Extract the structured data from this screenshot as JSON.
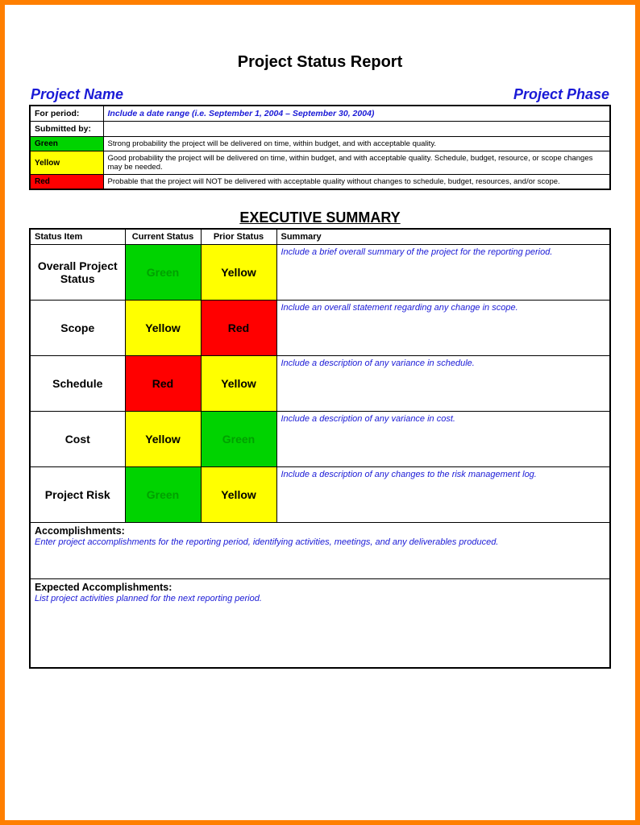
{
  "title": "Project Status Report",
  "subheadLeft": "Project Name",
  "subheadRight": "Project Phase",
  "info": {
    "periodLabel": "For period:",
    "periodInstr": "Include a date range (i.e. September 1, 2004 – September 30, 2004)",
    "submittedLabel": "Submitted by:"
  },
  "legend": {
    "green": {
      "name": "Green",
      "desc": "Strong probability the project will be delivered on time, within budget, and with acceptable quality."
    },
    "yellow": {
      "name": "Yellow",
      "desc": "Good probability the project will be delivered on time, within budget, and with acceptable quality. Schedule, budget, resource, or scope changes may be needed."
    },
    "red": {
      "name": "Red",
      "desc": "Probable that the project will NOT be delivered with acceptable quality without changes to schedule, budget, resources, and/or scope."
    }
  },
  "execTitle": "EXECUTIVE SUMMARY",
  "execHeaders": {
    "item": "Status Item",
    "current": "Current Status",
    "prior": "Prior Status",
    "summary": "Summary"
  },
  "rows": [
    {
      "item": "Overall Project Status",
      "current": "Green",
      "prior": "Yellow",
      "summary": "Include a brief overall summary of the project for the reporting period."
    },
    {
      "item": "Scope",
      "current": "Yellow",
      "prior": "Red",
      "summary": "Include an overall statement regarding any change in scope."
    },
    {
      "item": "Schedule",
      "current": "Red",
      "prior": "Yellow",
      "summary": "Include a description of any variance in schedule."
    },
    {
      "item": "Cost",
      "current": "Yellow",
      "prior": "Green",
      "summary": "Include a description of any variance in cost."
    },
    {
      "item": "Project Risk",
      "current": "Green",
      "prior": "Yellow",
      "summary": "Include a description of any changes to the risk management log."
    }
  ],
  "accomp": {
    "label": "Accomplishments:",
    "instr": "Enter project accomplishments for the reporting period, identifying activities, meetings, and any deliverables produced."
  },
  "expAccomp": {
    "label": "Expected Accomplishments:",
    "instr": "List project activities planned for the next reporting period."
  },
  "colors": {
    "Green": {
      "bg": "bg-green",
      "fg": "fg-green"
    },
    "Yellow": {
      "bg": "bg-yellow",
      "fg": ""
    },
    "Red": {
      "bg": "bg-red",
      "fg": ""
    }
  }
}
